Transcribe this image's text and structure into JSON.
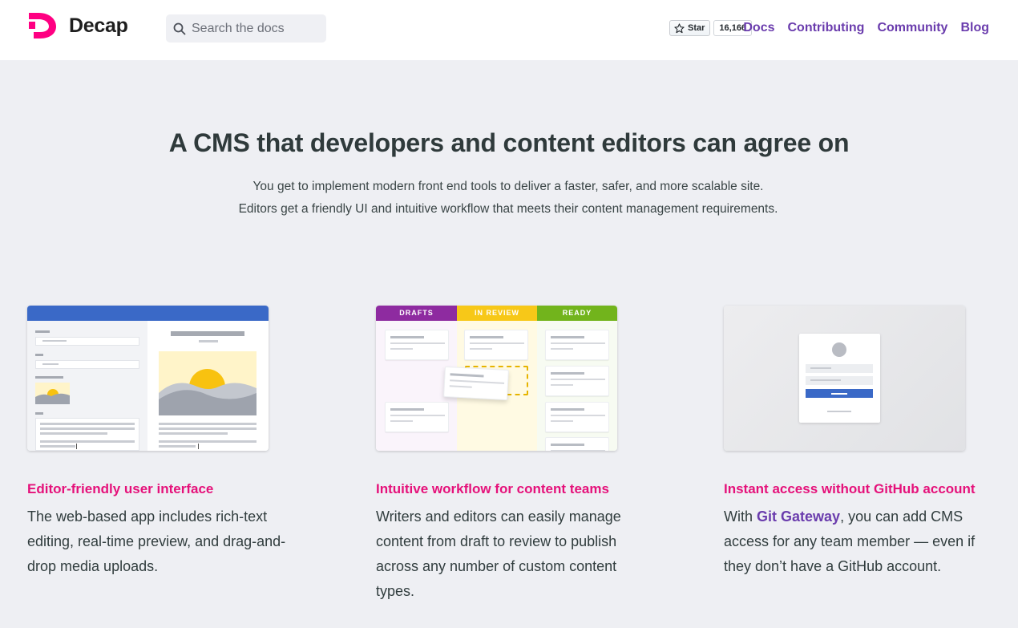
{
  "header": {
    "brand": "Decap",
    "search_placeholder": "Search the docs",
    "github": {
      "star_label": "Star",
      "star_count": "16,166"
    },
    "nav": [
      {
        "label": "Docs"
      },
      {
        "label": "Contributing"
      },
      {
        "label": "Community"
      },
      {
        "label": "Blog"
      }
    ]
  },
  "hero": {
    "title": "A CMS that developers and content editors can agree on",
    "subtitle_line1": "You get to implement modern front end tools to deliver a faster, safer, and more scalable site.",
    "subtitle_line2": "Editors get a friendly UI and intuitive workflow that meets their content management requirements."
  },
  "features": [
    {
      "title": "Editor-friendly user interface",
      "description": "The web-based app includes rich-text editing, real-time preview, and drag-and-drop media uploads."
    },
    {
      "title": "Intuitive workflow for content teams",
      "description": "Writers and editors can easily manage content from draft to review to publish across any number of custom content types.",
      "columns": [
        "DRAFTS",
        "IN REVIEW",
        "READY"
      ]
    },
    {
      "title": "Instant access without GitHub account",
      "description_prefix": "With ",
      "description_link": "Git Gateway",
      "description_suffix": ", you can add CMS access for any team member — even if they don’t have a GitHub account."
    }
  ],
  "colors": {
    "brand_pink": "#e5117a",
    "nav_purple": "#6a3cad",
    "editor_bar_blue": "#3a69c7",
    "drafts_purple": "#8e2ba0",
    "review_yellow": "#f7c818",
    "ready_green": "#72b41c"
  }
}
